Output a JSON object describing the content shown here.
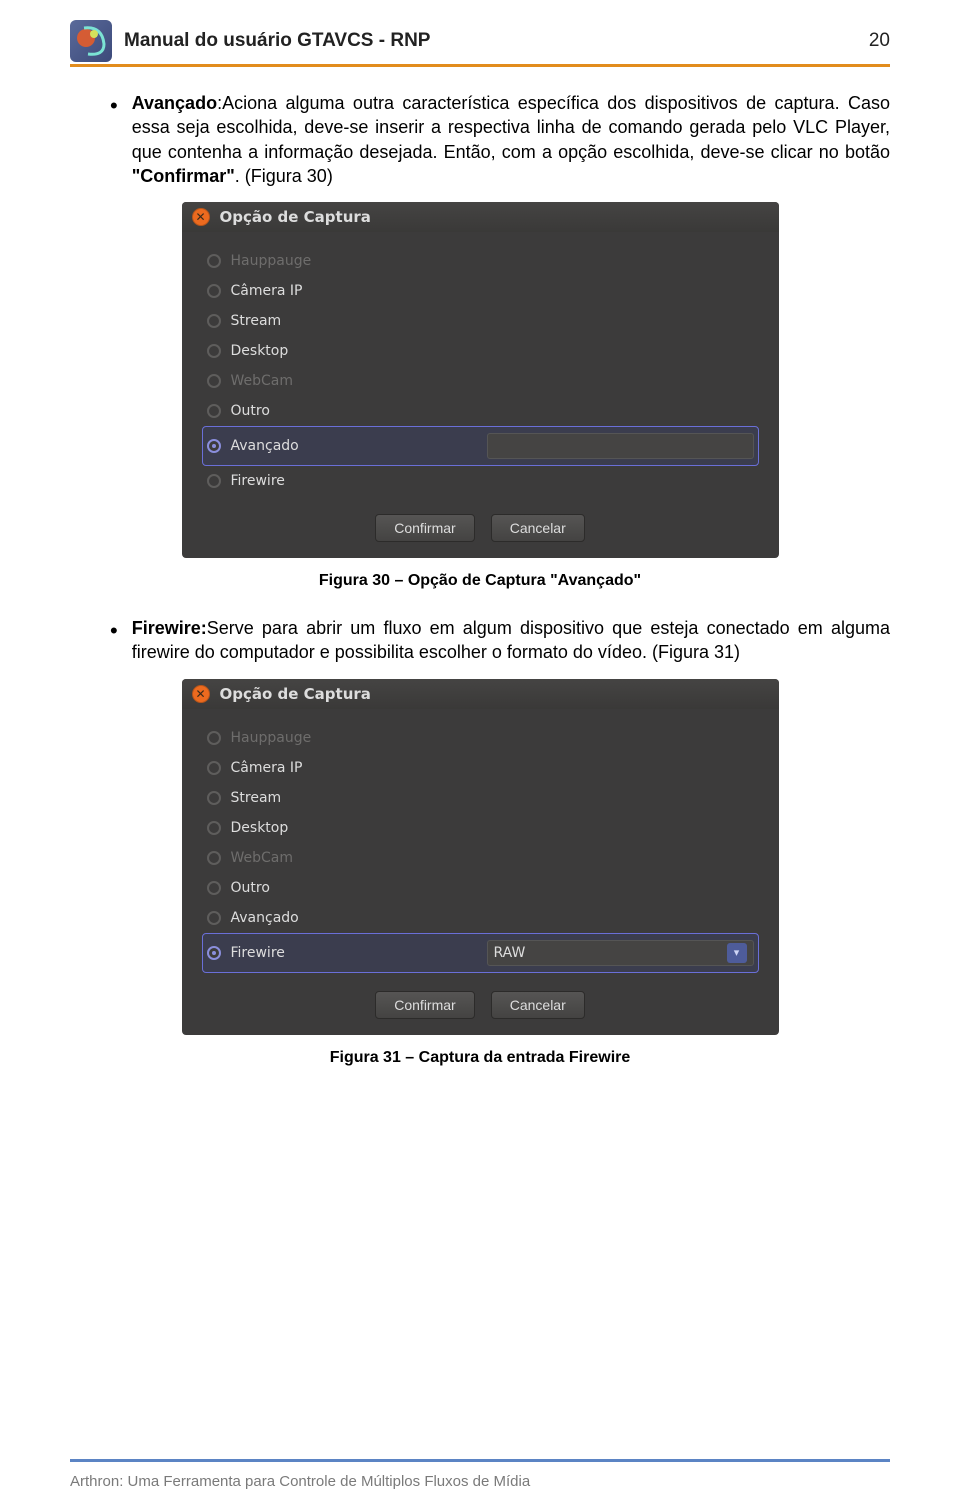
{
  "header": {
    "title": "Manual do usuário GTAVCS - RNP",
    "page_number": "20"
  },
  "paragraph1": {
    "bold_lead": "Avançado",
    "rest1": ":Aciona alguma outra característica específica dos dispositivos de captura. Caso essa seja escolhida, deve-se inserir a respectiva linha de comando gerada pelo VLC Player, que contenha a informação desejada. Então, com a opção escolhida, deve-se clicar no botão ",
    "bold_mid": "\"Confirmar\"",
    "rest2": ". (Figura 30)"
  },
  "dialog1": {
    "title": "Opção de Captura",
    "options": [
      {
        "label": "Hauppauge",
        "disabled": true
      },
      {
        "label": "Câmera IP",
        "disabled": false
      },
      {
        "label": "Stream",
        "disabled": false
      },
      {
        "label": "Desktop",
        "disabled": false
      },
      {
        "label": "WebCam",
        "disabled": true
      },
      {
        "label": "Outro",
        "disabled": false
      },
      {
        "label": "Avançado",
        "disabled": false,
        "selected": true,
        "has_input": true
      },
      {
        "label": "Firewire",
        "disabled": false
      }
    ],
    "confirm": "Confirmar",
    "cancel": "Cancelar"
  },
  "caption1": "Figura 30 – Opção de Captura \"Avançado\"",
  "paragraph2": {
    "bold_lead": "Firewire:",
    "rest1": "Serve para abrir um fluxo em algum dispositivo que esteja conectado em alguma firewire do computador e possibilita escolher o formato do vídeo. (Figura 31)"
  },
  "dialog2": {
    "title": "Opção de Captura",
    "options": [
      {
        "label": "Hauppauge",
        "disabled": true
      },
      {
        "label": "Câmera IP",
        "disabled": false
      },
      {
        "label": "Stream",
        "disabled": false
      },
      {
        "label": "Desktop",
        "disabled": false
      },
      {
        "label": "WebCam",
        "disabled": true
      },
      {
        "label": "Outro",
        "disabled": false
      },
      {
        "label": "Avançado",
        "disabled": false
      },
      {
        "label": "Firewire",
        "disabled": false,
        "selected": true,
        "has_select": true,
        "select_value": "RAW"
      }
    ],
    "confirm": "Confirmar",
    "cancel": "Cancelar"
  },
  "caption2": "Figura 31 – Captura da entrada Firewire",
  "footer": "Arthron: Uma Ferramenta para Controle de Múltiplos Fluxos de Mídia"
}
